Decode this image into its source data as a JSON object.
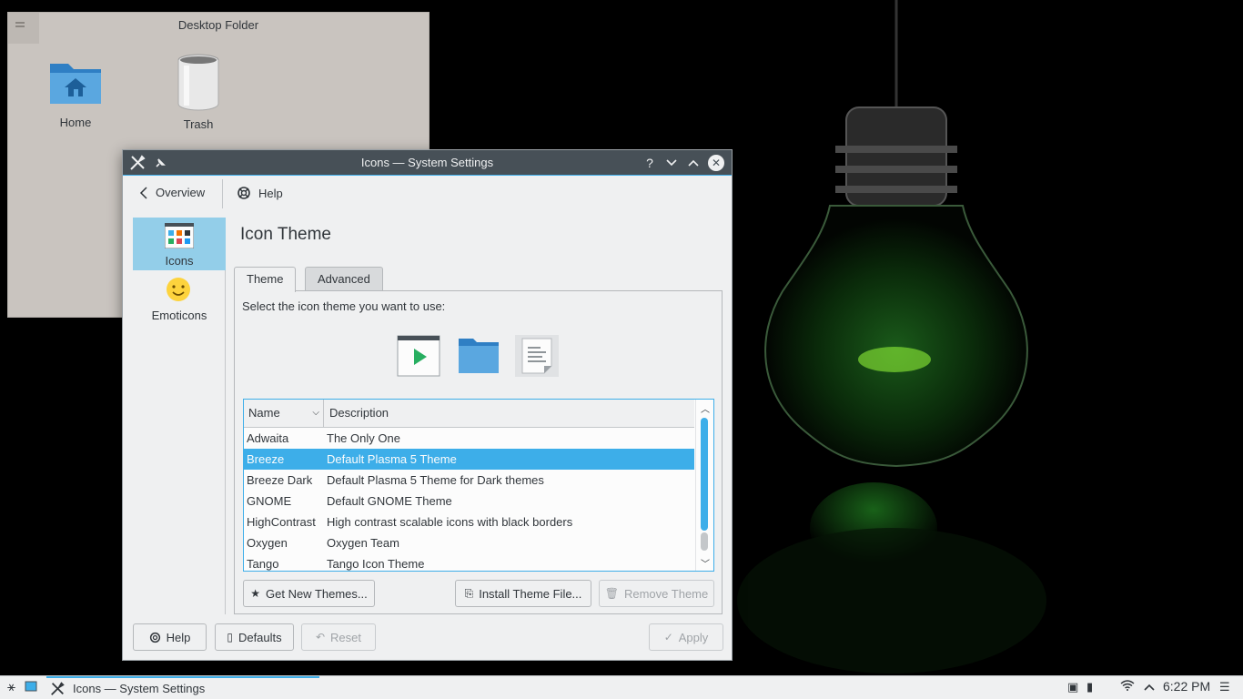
{
  "desktop": {
    "folder_title": "Desktop Folder",
    "icons": [
      {
        "label": "Home"
      },
      {
        "label": "Trash"
      }
    ]
  },
  "window": {
    "title": "Icons  — System Settings",
    "toolbar": {
      "overview": "Overview",
      "help": "Help"
    },
    "sidebar": [
      {
        "label": "Icons",
        "active": true
      },
      {
        "label": "Emoticons",
        "active": false
      }
    ],
    "page_title": "Icon Theme",
    "tabs": [
      {
        "label": "Theme",
        "active": true
      },
      {
        "label": "Advanced",
        "active": false
      }
    ],
    "prompt": "Select the icon theme you want to use:",
    "table": {
      "columns": [
        "Name",
        "Description"
      ],
      "rows": [
        {
          "name": "Adwaita",
          "desc": "The Only One",
          "selected": false
        },
        {
          "name": "Breeze",
          "desc": "Default Plasma 5 Theme",
          "selected": true
        },
        {
          "name": "Breeze Dark",
          "desc": "Default Plasma 5 Theme for Dark themes",
          "selected": false
        },
        {
          "name": "GNOME",
          "desc": "Default GNOME Theme",
          "selected": false
        },
        {
          "name": "HighContrast",
          "desc": "High contrast scalable icons with black borders",
          "selected": false
        },
        {
          "name": "Oxygen",
          "desc": "Oxygen Team",
          "selected": false
        },
        {
          "name": "Tango",
          "desc": "Tango Icon Theme",
          "selected": false
        }
      ]
    },
    "buttons": {
      "get_new": "Get New Themes...",
      "install": "Install Theme File...",
      "remove": "Remove Theme",
      "help": "Help",
      "defaults": "Defaults",
      "reset": "Reset",
      "apply": "Apply"
    }
  },
  "taskbar": {
    "task_label": "Icons  — System Settings",
    "clock": "6:22 PM"
  },
  "colors": {
    "accent": "#3daee9",
    "titlebar": "#475057",
    "selection_sidebar": "#93cee9",
    "window_bg": "#eff0f1"
  }
}
